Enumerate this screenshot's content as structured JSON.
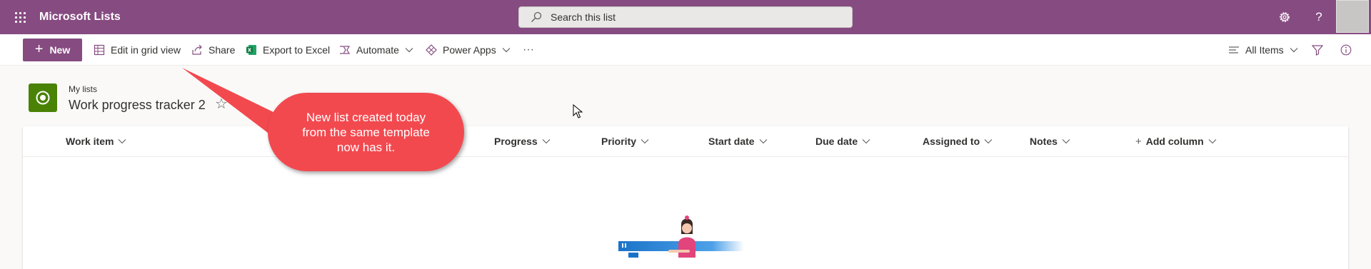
{
  "suite_header": {
    "app_name": "Microsoft Lists",
    "search_placeholder": "Search this list",
    "icons": [
      "app-launcher-icon",
      "settings-gear-icon",
      "help-question-icon",
      "user-avatar"
    ]
  },
  "command_bar": {
    "new_label": "New",
    "edit_grid_label": "Edit in grid view",
    "share_label": "Share",
    "export_label": "Export to Excel",
    "automate_label": "Automate",
    "power_apps_label": "Power Apps",
    "more_label": "···",
    "view_label": "All Items"
  },
  "list_header": {
    "breadcrumb": "My lists",
    "title": "Work progress tracker 2",
    "favorite_icon": "☆"
  },
  "columns": [
    "Work item",
    "Progress",
    "Priority",
    "Start date",
    "Due date",
    "Assigned to",
    "Notes",
    "Add column"
  ],
  "callout": {
    "text": "New list created today from the same template now has it."
  },
  "colors": {
    "suite_bar": "#864b81",
    "list_icon": "#498205",
    "callout": "#f2494f"
  }
}
